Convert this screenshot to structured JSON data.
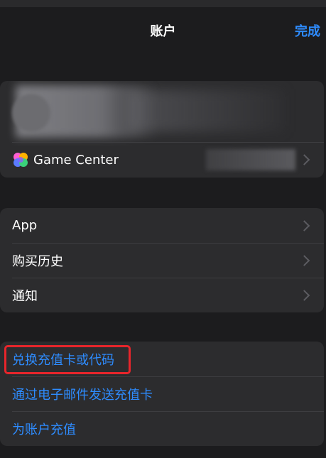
{
  "nav": {
    "title": "账户",
    "done_label": "完成"
  },
  "profile": {
    "game_center_label": "Game Center"
  },
  "menu": {
    "items": [
      {
        "label": "App"
      },
      {
        "label": "购买历史"
      },
      {
        "label": "通知"
      }
    ]
  },
  "actions": {
    "items": [
      {
        "label": "兑换充值卡或代码"
      },
      {
        "label": "通过电子邮件发送充值卡"
      },
      {
        "label": "为账户充值"
      }
    ]
  },
  "colors": {
    "background": "#1c1c1e",
    "cell": "#2c2c2e",
    "accent": "#2e8cff",
    "highlight": "#e8252b"
  }
}
